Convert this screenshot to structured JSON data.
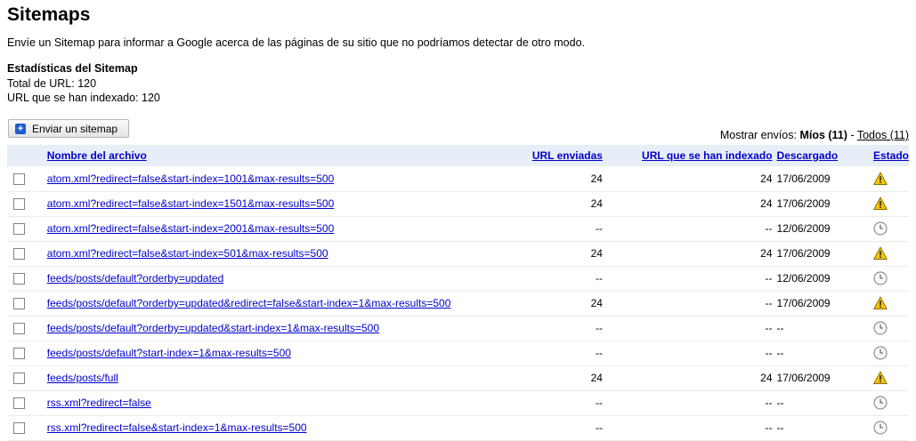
{
  "page": {
    "title": "Sitemaps",
    "description": "Envíe un Sitemap para informar a Google acerca de las páginas de su sitio que no podríamos detectar de otro modo.",
    "stats_heading": "Estadísticas del Sitemap",
    "total_urls": "Total de URL: 120",
    "indexed_urls": "URL que se han indexado: 120",
    "submit_button": "Enviar un sitemap"
  },
  "filter": {
    "label": "Mostrar envíos:",
    "mine": "Míos (11)",
    "separator": "-",
    "all": "Todos (11)"
  },
  "table": {
    "headers": [
      "Nombre del archivo",
      "URL enviadas",
      "URL que se han indexado",
      "Descargado",
      "Estado"
    ],
    "rows": [
      {
        "name": "atom.xml?redirect=false&start-index=1001&max-results=500",
        "sent": "24",
        "indexed": "24",
        "date": "17/06/2009",
        "status": "warning-icon"
      },
      {
        "name": "atom.xml?redirect=false&start-index=1501&max-results=500",
        "sent": "24",
        "indexed": "24",
        "date": "17/06/2009",
        "status": "warning-icon"
      },
      {
        "name": "atom.xml?redirect=false&start-index=2001&max-results=500",
        "sent": "--",
        "indexed": "--",
        "date": "12/06/2009",
        "status": "clock-icon"
      },
      {
        "name": "atom.xml?redirect=false&start-index=501&max-results=500",
        "sent": "24",
        "indexed": "24",
        "date": "17/06/2009",
        "status": "warning-icon"
      },
      {
        "name": "feeds/posts/default?orderby=updated",
        "sent": "--",
        "indexed": "--",
        "date": "12/06/2009",
        "status": "clock-icon"
      },
      {
        "name": "feeds/posts/default?orderby=updated&redirect=false&start-index=1&max-results=500",
        "sent": "24",
        "indexed": "--",
        "date": "17/06/2009",
        "status": "warning-icon"
      },
      {
        "name": "feeds/posts/default?orderby=updated&start-index=1&max-results=500",
        "sent": "--",
        "indexed": "--",
        "date": "--",
        "status": "clock-icon"
      },
      {
        "name": "feeds/posts/default?start-index=1&max-results=500",
        "sent": "--",
        "indexed": "--",
        "date": "--",
        "status": "clock-icon"
      },
      {
        "name": "feeds/posts/full",
        "sent": "24",
        "indexed": "24",
        "date": "17/06/2009",
        "status": "warning-icon"
      },
      {
        "name": "rss.xml?redirect=false",
        "sent": "--",
        "indexed": "--",
        "date": "--",
        "status": "clock-icon"
      },
      {
        "name": "rss.xml?redirect=false&start-index=1&max-results=500",
        "sent": "--",
        "indexed": "--",
        "date": "--",
        "status": "clock-icon"
      }
    ]
  },
  "colors": {
    "link": "#0000cc",
    "header_bg": "#e8eef7",
    "warning": "#f5c400",
    "button_icon": "#1f5ecf"
  }
}
